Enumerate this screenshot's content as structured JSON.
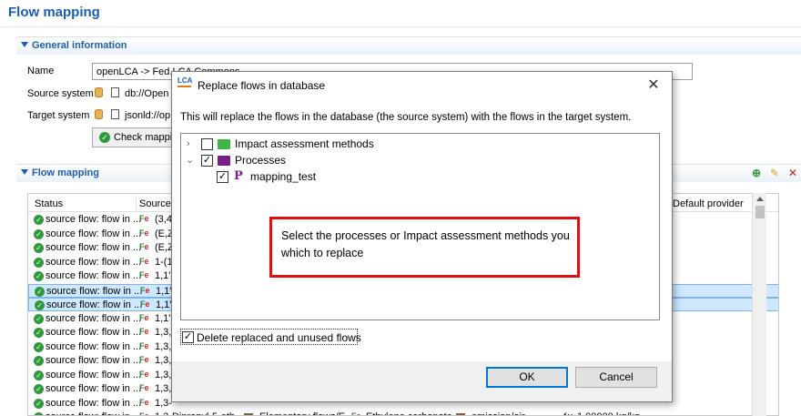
{
  "editor": {
    "title": "Flow mapping",
    "general_section": "General information",
    "name_label": "Name",
    "name_value": "openLCA -> Fed.LCA Commons",
    "source_label": "Source system",
    "source_value": "db://Open",
    "target_label": "Target system",
    "target_value": "jsonld://op",
    "check_button": "Check mappin",
    "mapping_section": "Flow mapping"
  },
  "table": {
    "columns": [
      "Status",
      "Source",
      "Default provider"
    ],
    "rows": [
      {
        "status": "source flow: flow in ...",
        "source": "(3,4-",
        "selected": false
      },
      {
        "status": "source flow: flow in ...",
        "source": "(E,Z)",
        "selected": false
      },
      {
        "status": "source flow: flow in ...",
        "source": "(E,Z)",
        "selected": false
      },
      {
        "status": "source flow: flow in ...",
        "source": "1-(1",
        "selected": false
      },
      {
        "status": "source flow: flow in ...",
        "source": "1,1'-",
        "selected": false
      },
      {
        "status": "source flow: flow in ...",
        "source": "1,1'-",
        "selected": true
      },
      {
        "status": "source flow: flow in ...",
        "source": "1,1'-",
        "selected": true
      },
      {
        "status": "source flow: flow in ...",
        "source": "1,1'-",
        "selected": false
      },
      {
        "status": "source flow: flow in ...",
        "source": "1,3,5",
        "selected": false
      },
      {
        "status": "source flow: flow in ...",
        "source": "1,3,5",
        "selected": false
      },
      {
        "status": "source flow: flow in ...",
        "source": "1,3,5",
        "selected": false
      },
      {
        "status": "source flow: flow in ...",
        "source": "1,3,5",
        "selected": false
      },
      {
        "status": "source flow: flow in ...",
        "source": "1,3,5",
        "selected": false
      },
      {
        "status": "source flow: flow in ...",
        "source": "1,3-",
        "selected": false
      },
      {
        "status": "source flow: flow in ...",
        "source": "1,3-Dipropyl-5-eth...",
        "selected": false,
        "category": "Elementary flows/E...",
        "target": "Ethylene carbonate",
        "compartment": "emission/air",
        "factor": "1.00000 kg/kg"
      }
    ]
  },
  "dialog": {
    "title": "Replace flows in database",
    "logo": "LCA",
    "message": "This will replace the flows in the database (the source system) with the flows in the target system.",
    "tree": {
      "impact": {
        "label": "Impact assessment methods",
        "checked": false,
        "expanded": false
      },
      "processes": {
        "label": "Processes",
        "checked": true,
        "expanded": true
      },
      "process_item": {
        "label": "mapping_test",
        "checked": true,
        "icon": "P"
      }
    },
    "delete_label": "Delete replaced and unused flows",
    "delete_checked": true,
    "ok": "OK",
    "cancel": "Cancel",
    "close": "✕"
  },
  "annotation": {
    "text": "Select the processes or Impact assessment methods you which to replace",
    "color": "#e01010"
  },
  "colors": {
    "accent": "#1b5eb0",
    "selection": "#cde8ff",
    "status_ok": "#2f9a3a"
  }
}
